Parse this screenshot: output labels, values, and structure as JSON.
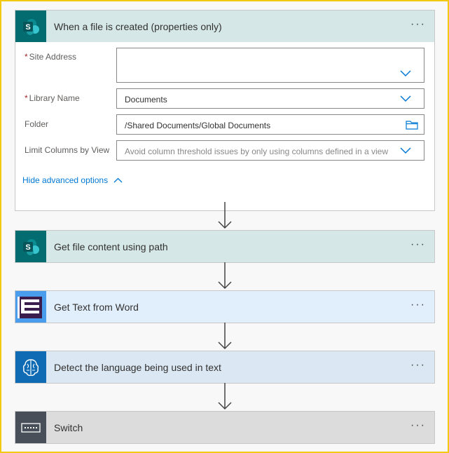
{
  "trigger": {
    "title": "When a file is created (properties only)",
    "icon": "sharepoint-icon",
    "header_color": "#d5e7e7",
    "icon_bg": "#036c70",
    "fields": {
      "site_address": {
        "label": "Site Address",
        "required": "*",
        "value": ""
      },
      "library_name": {
        "label": "Library Name",
        "required": "*",
        "value": "Documents"
      },
      "folder": {
        "label": "Folder",
        "value": "/Shared Documents/Global Documents"
      },
      "limit_columns": {
        "label": "Limit Columns by View",
        "placeholder": "Avoid column threshold issues by only using columns defined in a view"
      }
    },
    "advanced_label": "Hide advanced options"
  },
  "steps": [
    {
      "title": "Get file content using path",
      "icon": "sharepoint-icon",
      "header_color": "#d5e7e7",
      "icon_bg": "#036c70"
    },
    {
      "title": "Get Text from Word",
      "icon": "word-text-icon",
      "header_color": "#e1effd",
      "icon_bg": "#4a9ded"
    },
    {
      "title": "Detect the language being used in text",
      "icon": "cognitive-services-icon",
      "header_color": "#dbe8f3",
      "icon_bg": "#0f6bb3"
    },
    {
      "title": "Switch",
      "icon": "switch-icon",
      "header_color": "#dcdcdc",
      "icon_bg": "#484f58"
    }
  ],
  "more_label": "···"
}
